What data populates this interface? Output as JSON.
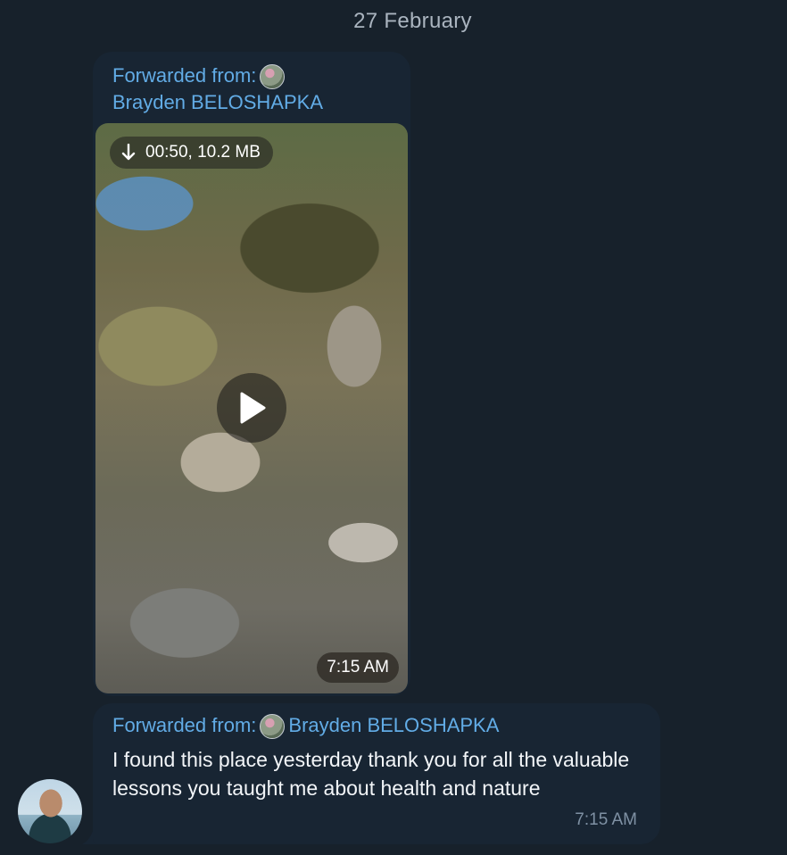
{
  "date_separator": "27 February",
  "video_message": {
    "forwarded_label": "Forwarded from:",
    "forwarded_name": "Brayden BELOSHAPKA",
    "video_meta": "00:50, 10.2 MB",
    "time": "7:15 AM"
  },
  "text_message": {
    "forwarded_label": "Forwarded from:",
    "forwarded_name": "Brayden BELOSHAPKA",
    "text": "I found this place yesterday thank you for all the valuable lessons you taught me about health and nature",
    "time": "7:15 AM"
  },
  "icons": {
    "download": "download-arrow-icon",
    "play": "play-icon"
  },
  "colors": {
    "background": "#17212b",
    "bubble": "#182533",
    "accent": "#62ace6",
    "text": "#f2f5f8",
    "muted": "#7f91a4"
  }
}
